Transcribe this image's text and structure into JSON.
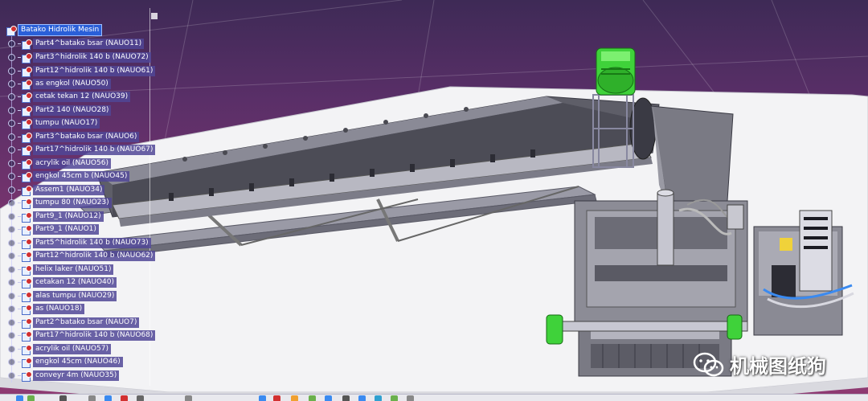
{
  "tree": {
    "root": "Batako Hidrolik Mesin",
    "items": [
      "Part4^batako bsar (NAUO11)",
      "Part3^hidrolik 140 b (NAUO72)",
      "Part12^hidrolik 140 b (NAUO61)",
      "as engkol (NAUO50)",
      "cetak tekan 12 (NAUO39)",
      "Part2 140 (NAUO28)",
      "tumpu (NAUO17)",
      "Part3^batako bsar (NAUO6)",
      "Part17^hidrolik 140 b (NAUO67)",
      "acrylik oil (NAUO56)",
      "engkol 45cm b (NAUO45)",
      "Assem1 (NAUO34)",
      "tumpu 80 (NAUO23)",
      "Part9_1 (NAUO12)",
      "Part9_1 (NAUO1)",
      "Part5^hidrolik 140 b (NAUO73)",
      "Part12^hidrolik 140 b (NAUO62)",
      "helix laker (NAUO51)",
      "cetakan 12 (NAUO40)",
      "alas tumpu (NAUO29)",
      "as (NAUO18)",
      "Part2^batako bsar (NAUO7)",
      "Part17^hidrolik 140 b (NAUO68)",
      "acrylik oil (NAUO57)",
      "engkol 45cm (NAUO46)",
      "conveyr 4m (NAUO35)"
    ]
  },
  "watermark": {
    "text": "机械图纸狗",
    "icon": "wechat-icon"
  },
  "colors": {
    "background_top": "#3e2a56",
    "background_bottom": "#8f3a72",
    "selection": "#2a5fd8",
    "motor_green": "#3fd23a"
  },
  "toolbar": {
    "icons": [
      "cursor-icon",
      "rotate-icon",
      "pan-icon",
      "zoom-icon",
      "fit-icon",
      "view-icon",
      "render-icon",
      "measure-icon"
    ]
  }
}
